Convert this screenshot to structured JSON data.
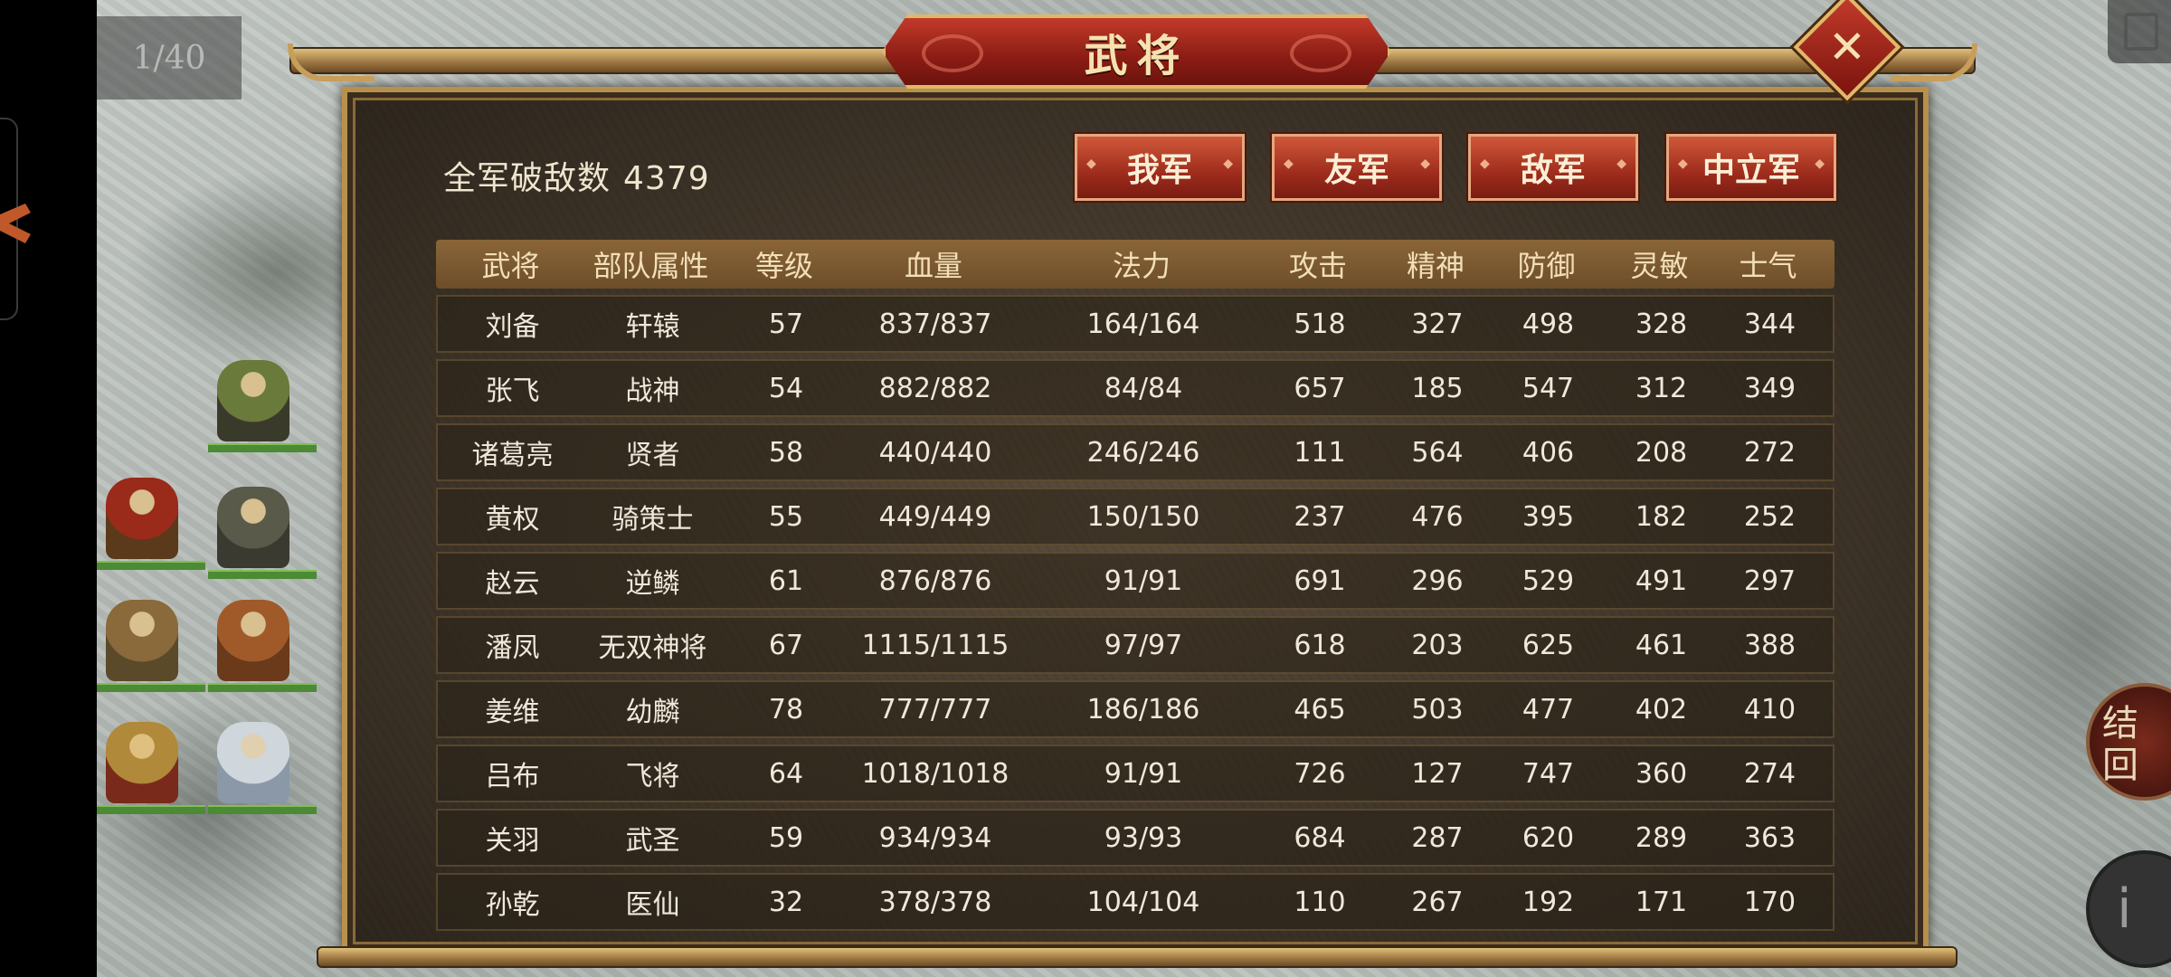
{
  "hud": {
    "page_counter": "1/40",
    "side_result_label": "结\n回",
    "side_info_label": "i"
  },
  "dialog": {
    "title": "武将",
    "close_icon": "close-x-icon",
    "kills_label": "全军破敌数",
    "kills_value": "4379",
    "factions": [
      "我军",
      "友军",
      "敌军",
      "中立军"
    ]
  },
  "table": {
    "columns": [
      "武将",
      "部队属性",
      "等级",
      "血量",
      "法力",
      "攻击",
      "精神",
      "防御",
      "灵敏",
      "士气"
    ],
    "rows": [
      [
        "刘备",
        "轩辕",
        "57",
        "837/837",
        "164/164",
        "518",
        "327",
        "498",
        "328",
        "344"
      ],
      [
        "张飞",
        "战神",
        "54",
        "882/882",
        "84/84",
        "657",
        "185",
        "547",
        "312",
        "349"
      ],
      [
        "诸葛亮",
        "贤者",
        "58",
        "440/440",
        "246/246",
        "111",
        "564",
        "406",
        "208",
        "272"
      ],
      [
        "黄权",
        "骑策士",
        "55",
        "449/449",
        "150/150",
        "237",
        "476",
        "395",
        "182",
        "252"
      ],
      [
        "赵云",
        "逆鳞",
        "61",
        "876/876",
        "91/91",
        "691",
        "296",
        "529",
        "491",
        "297"
      ],
      [
        "潘凤",
        "无双神将",
        "67",
        "1115/1115",
        "97/97",
        "618",
        "203",
        "625",
        "461",
        "388"
      ],
      [
        "姜维",
        "幼麟",
        "78",
        "777/777",
        "186/186",
        "465",
        "503",
        "477",
        "402",
        "410"
      ],
      [
        "吕布",
        "飞将",
        "64",
        "1018/1018",
        "91/91",
        "726",
        "127",
        "747",
        "360",
        "274"
      ],
      [
        "关羽",
        "武圣",
        "59",
        "934/934",
        "93/93",
        "684",
        "287",
        "620",
        "289",
        "363"
      ],
      [
        "孙乾",
        "医仙",
        "32",
        "378/378",
        "104/104",
        "110",
        "267",
        "192",
        "171",
        "170"
      ]
    ]
  },
  "colors": {
    "accent_red": "#9e2c1c",
    "gold_trim": "#b8904e",
    "header_bar": "#7a5830"
  }
}
